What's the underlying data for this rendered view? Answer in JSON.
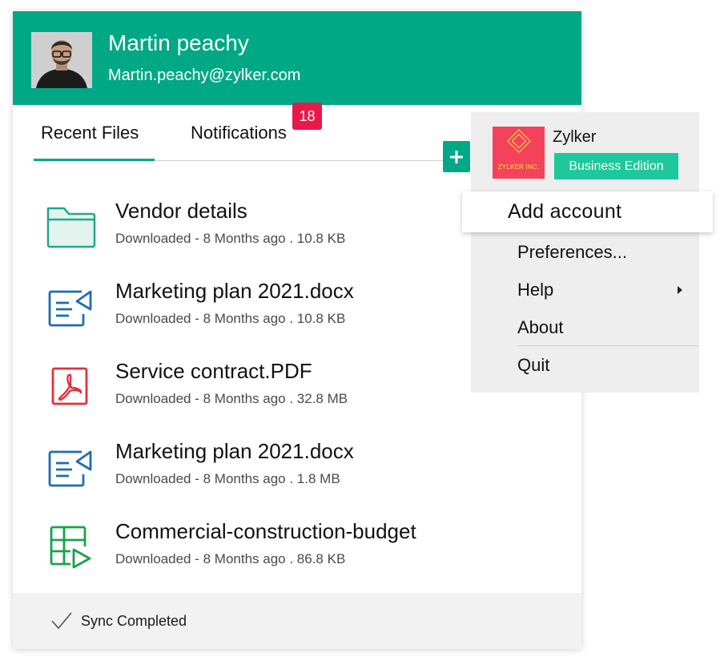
{
  "user": {
    "name": "Martin peachy",
    "email": "Martin.peachy@zylker.com"
  },
  "tabs": {
    "recent": "Recent Files",
    "notifications": "Notifications",
    "notification_count": "18"
  },
  "files": [
    {
      "name": "Vendor details",
      "meta": "Downloaded - 8 Months ago . 10.8 KB",
      "icon": "folder-icon"
    },
    {
      "name": "Marketing plan 2021.docx",
      "meta": "Downloaded - 8 Months ago . 10.8 KB",
      "icon": "document-icon"
    },
    {
      "name": "Service contract.PDF",
      "meta": "Downloaded - 8 Months ago . 32.8 MB",
      "icon": "pdf-icon"
    },
    {
      "name": "Marketing plan 2021.docx",
      "meta": "Downloaded - 8 Months ago . 1.8 MB",
      "icon": "document-icon"
    },
    {
      "name": "Commercial-construction-budget",
      "meta": "Downloaded - 8 Months ago . 86.8 KB",
      "icon": "spreadsheet-icon"
    }
  ],
  "footer": {
    "status": "Sync Completed",
    "icon": "checkmark-icon"
  },
  "menu": {
    "org_name": "Zylker",
    "org_logo_text": "ZYLKER INC.",
    "edition": "Business Edition",
    "add_account": "Add account",
    "items": [
      "Preferences...",
      "Help",
      "About",
      "Quit"
    ]
  },
  "colors": {
    "brand": "#00a886",
    "badge": "#e8194a",
    "edition": "#1ec89a",
    "org_logo": "#f5425b",
    "doc_icon": "#1f6bb8",
    "pdf_icon": "#e0323b",
    "sheet_icon": "#16a34a"
  }
}
